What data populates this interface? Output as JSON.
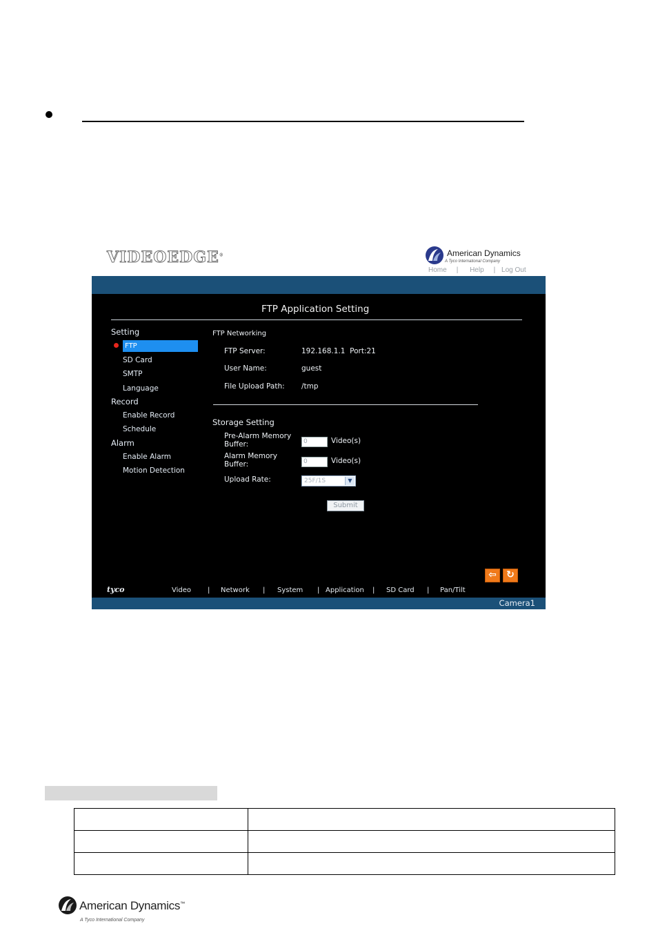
{
  "screen": {
    "brand": {
      "product_logo": "VIDEOEDGE",
      "company": "American Dynamics",
      "company_sub": "A Tyco International Company"
    },
    "top_links": [
      "Home",
      "Help",
      "Log Out"
    ],
    "title": "FTP Application Setting",
    "sidebar": {
      "groups": [
        {
          "heading": "Setting",
          "items": [
            "FTP",
            "SD Card",
            "SMTP",
            "Language"
          ]
        },
        {
          "heading": "Record",
          "items": [
            "Enable Record",
            "Schedule"
          ]
        },
        {
          "heading": "Alarm",
          "items": [
            "Enable Alarm",
            "Motion Detection"
          ]
        }
      ],
      "selected": "FTP"
    },
    "ftp": {
      "section": "FTP Networking",
      "server_label": "FTP Server:",
      "server_value": "192.168.1.1  Port:21",
      "user_label": "User Name:",
      "user_value": "guest",
      "path_label": "File Upload Path:",
      "path_value": "/tmp"
    },
    "storage": {
      "section": "Storage Setting",
      "pre_label_1": "Pre-Alarm Memory",
      "pre_label_2": "Buffer:",
      "pre_value": "0",
      "pre_unit": "Video(s)",
      "alarm_label_1": "Alarm Memory",
      "alarm_label_2": "Buffer:",
      "alarm_value": "0",
      "alarm_unit": "Video(s)",
      "rate_label": "Upload Rate:",
      "rate_value": "25F/1S"
    },
    "submit_label": "Submit",
    "bottom_brand": "tyco",
    "bottom_nav": [
      "Video",
      "Network",
      "System",
      "Application",
      "SD Card",
      "Pan/Tilt"
    ],
    "camera": "Camera1",
    "colors": {
      "bar": "#1b5078",
      "panel": "#000000",
      "selected": "#1e8ff0",
      "nav_buttons": "#f07a1a"
    },
    "icons": {
      "back": "arrow-left-icon",
      "refresh": "refresh-icon"
    }
  },
  "footer": {
    "company": "American Dynamics",
    "tm": "™",
    "sub": "A Tyco International Company"
  }
}
